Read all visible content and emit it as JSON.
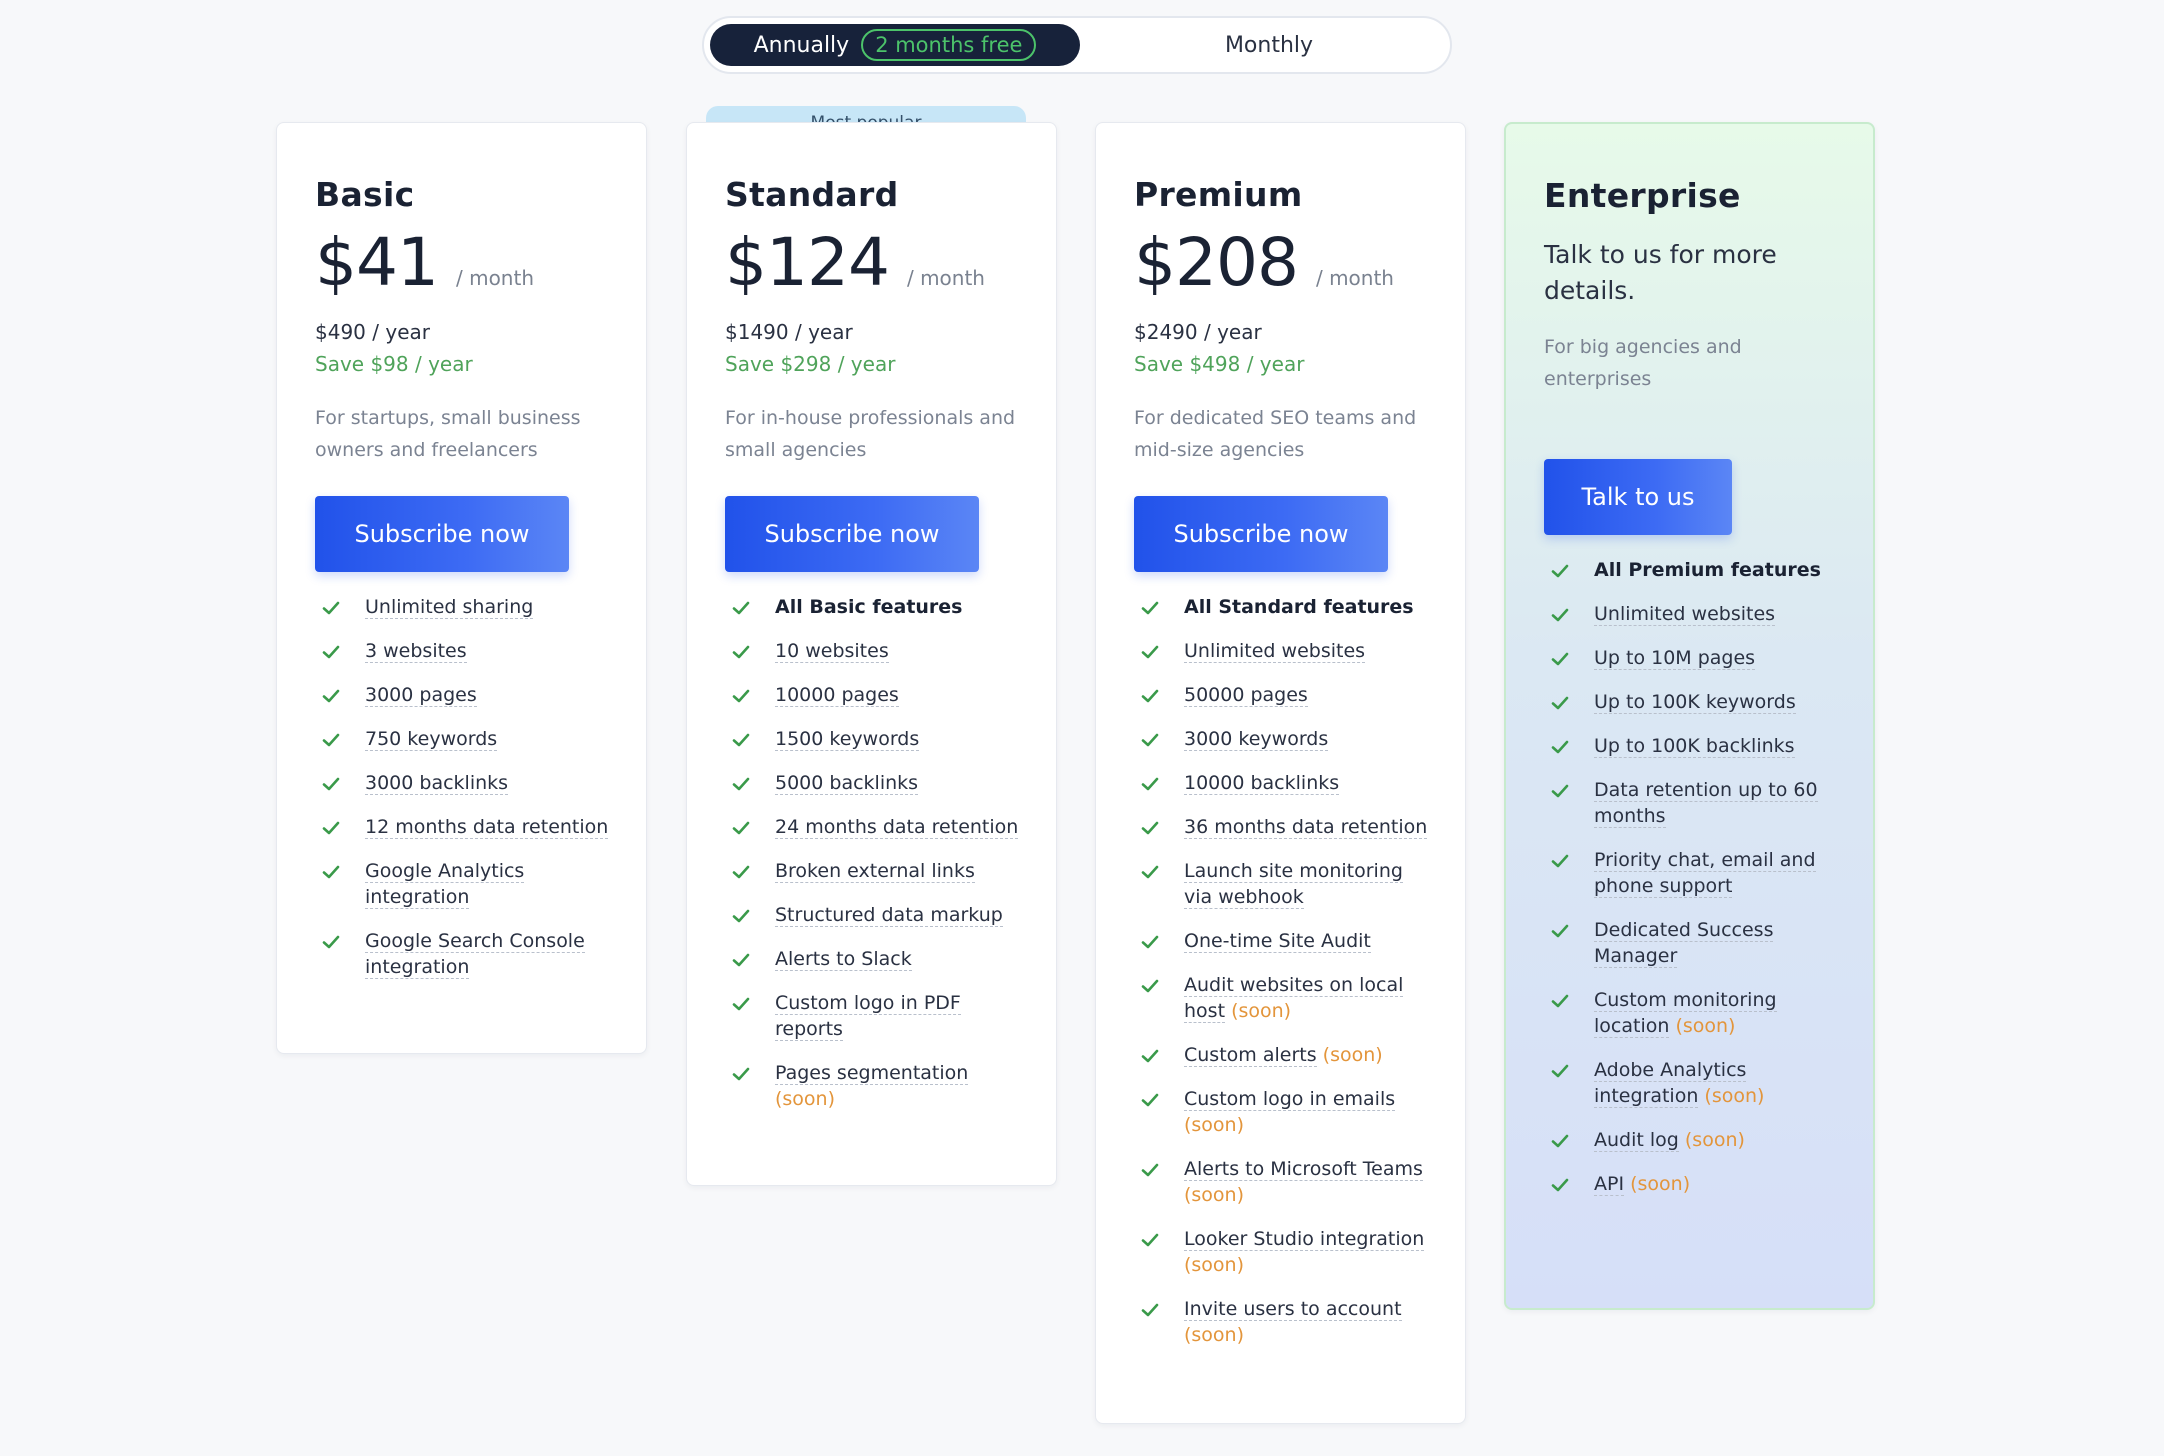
{
  "billing_toggle": {
    "annual_label": "Annually",
    "annual_badge": "2 months free",
    "monthly_label": "Monthly",
    "selected": "Annually"
  },
  "colors": {
    "accent_blue": "#2152ea",
    "save_green": "#4fa35a",
    "soon_orange": "#e3953b",
    "check_green": "#3a9a4a"
  },
  "plans": [
    {
      "name": "Basic",
      "price": "$41",
      "per": "/ month",
      "yearly": "$490 / year",
      "save": "Save $98 / year",
      "description": "For startups, small business owners and freelancers",
      "cta": "Subscribe now",
      "features": [
        {
          "text": "Unlimited sharing"
        },
        {
          "text": "3 websites"
        },
        {
          "text": "3000 pages"
        },
        {
          "text": "750 keywords"
        },
        {
          "text": "3000 backlinks"
        },
        {
          "text": "12 months data retention"
        },
        {
          "text": "Google Analytics integration"
        },
        {
          "text": "Google Search Console integration"
        }
      ]
    },
    {
      "name": "Standard",
      "badge": "Most popular",
      "price": "$124",
      "per": "/ month",
      "yearly": "$1490 / year",
      "save": "Save $298 / year",
      "description": "For in-house professionals and small agencies",
      "cta": "Subscribe now",
      "features": [
        {
          "text": "All Basic features",
          "bold": true
        },
        {
          "text": "10 websites"
        },
        {
          "text": "10000 pages"
        },
        {
          "text": "1500 keywords"
        },
        {
          "text": "5000 backlinks"
        },
        {
          "text": "24 months data retention"
        },
        {
          "text": "Broken external links"
        },
        {
          "text": "Structured data markup"
        },
        {
          "text": "Alerts to Slack"
        },
        {
          "text": "Custom logo in PDF reports"
        },
        {
          "text": "Pages segmentation",
          "soon": "(soon)"
        }
      ]
    },
    {
      "name": "Premium",
      "price": "$208",
      "per": "/ month",
      "yearly": "$2490 / year",
      "save": "Save $498 / year",
      "description": "For dedicated SEO teams and mid-size agencies",
      "cta": "Subscribe now",
      "features": [
        {
          "text": "All Standard features",
          "bold": true
        },
        {
          "text": "Unlimited websites"
        },
        {
          "text": "50000 pages"
        },
        {
          "text": "3000 keywords"
        },
        {
          "text": "10000 backlinks"
        },
        {
          "text": "36 months data retention"
        },
        {
          "text": "Launch site monitoring via webhook"
        },
        {
          "text": "One-time Site Audit"
        },
        {
          "text": "Audit websites on local host",
          "soon": "(soon)"
        },
        {
          "text": "Custom alerts",
          "soon": "(soon)"
        },
        {
          "text": "Custom logo in emails",
          "soon": "(soon)"
        },
        {
          "text": "Alerts to Microsoft Teams",
          "soon": "(soon)"
        },
        {
          "text": "Looker Studio integration",
          "soon": "(soon)"
        },
        {
          "text": "Invite users to account",
          "soon": "(soon)"
        }
      ]
    },
    {
      "name": "Enterprise",
      "tagline": "Talk to us for more details.",
      "description": "For big agencies and enterprises",
      "cta": "Talk to us",
      "features": [
        {
          "text": "All Premium features",
          "bold": true
        },
        {
          "text": "Unlimited websites"
        },
        {
          "text": "Up to 10M pages"
        },
        {
          "text": "Up to 100K keywords"
        },
        {
          "text": "Up to 100K backlinks"
        },
        {
          "text": "Data retention up to 60 months"
        },
        {
          "text": "Priority chat, email and phone support"
        },
        {
          "text": "Dedicated Success Manager"
        },
        {
          "text": "Custom monitoring location",
          "soon": "(soon)"
        },
        {
          "text": "Adobe Analytics integration",
          "soon": "(soon)"
        },
        {
          "text": "Audit log",
          "soon": "(soon)"
        },
        {
          "text": "API",
          "soon": "(soon)"
        }
      ]
    }
  ]
}
